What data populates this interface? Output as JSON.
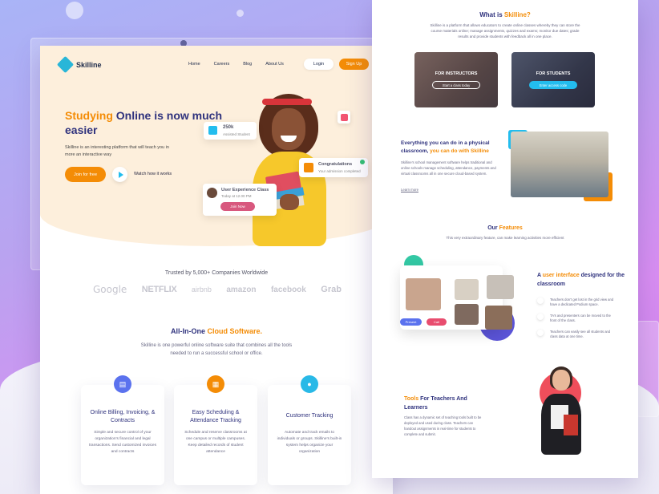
{
  "left_page": {
    "logo": "Skilline",
    "nav": [
      "Home",
      "Careers",
      "Blog",
      "About Us"
    ],
    "login": "Login",
    "signup": "Sign Up",
    "hero_title_accent": "Studying",
    "hero_title_rest": " Online is now much easier",
    "hero_sub": "Skilline is an interesting platform that will teach you in more an interactive way",
    "join_btn": "Join for free",
    "watch": "Watch how it works",
    "card_students_num": "250k",
    "card_students_label": "Assisted Student",
    "card_congrats_title": "Congratulations",
    "card_congrats_sub": "Your admission completed",
    "card_class_title": "User Experience Class",
    "card_class_time": "Today at 12.00 PM",
    "card_class_btn": "Join Now",
    "trusted": "Trusted by 5,000+ Companies Worldwide",
    "logos": [
      "Google",
      "NETFLIX",
      "airbnb",
      "amazon",
      "facebook",
      "Grab"
    ],
    "aio_title_prefix": "All-In-One ",
    "aio_title_accent": "Cloud Software.",
    "aio_desc": "Skilline is one powerful online software suite that combines all the tools needed to run a successful school or office.",
    "features": [
      {
        "title": "Online Billing, Invoicing, & Contracts",
        "desc": "Simple and secure control of your organization’s financial and legal transactions. Send customized invoices and contracts",
        "color": "#5b72ee",
        "icon": "document-icon"
      },
      {
        "title": "Easy Scheduling & Attendance Tracking",
        "desc": "Schedule and reserve classrooms at one campus or multiple campuses. Keep detailed records of student attendance",
        "color": "#f48c06",
        "icon": "calendar-icon"
      },
      {
        "title": "Customer Tracking",
        "desc": "Automate and track emails to individuals or groups. Skilline’s built-in system helps organize your organization",
        "color": "#29b9e7",
        "icon": "users-icon"
      }
    ]
  },
  "right_page": {
    "what_prefix": "What is ",
    "what_accent": "Skilline?",
    "what_desc": "Skilline is a platform that allows educators to create online classes whereby they can store the course materials online; manage assignments, quizzes and exams; monitor due dates; grade results and provide students with feedback all in one place.",
    "instructors_title": "FOR INSTRUCTORS",
    "instructors_btn": "Start a class today",
    "students_title": "FOR STUDENTS",
    "students_btn": "Enter access code",
    "sec2_title_a": "Everything you can do in a physical classroom, ",
    "sec2_title_accent": "you can do with Skilline",
    "sec2_desc": "Skilline’s school management software helps traditional and online schools manage scheduling, attendance, payments and virtual classrooms all in one secure cloud-based system.",
    "learn_more": "Learn more",
    "feat_prefix": "Our ",
    "feat_accent": "Features",
    "feat_desc": "This very extraordinary feature, can make learning activities more efficient",
    "present_btn": "Present",
    "call_btn": "Call",
    "ui_title_a": "A ",
    "ui_title_accent": "user interface",
    "ui_title_b": " designed for the classroom",
    "ui_items": [
      "Teachers don’t get lost in the grid view and have a dedicated Podium space.",
      "TA’s and presenters can be moved to the front of the class.",
      "Teachers can easily see all students and class data at one time."
    ],
    "tools_accent": "Tools",
    "tools_title_rest": " For Teachers And Learners",
    "tools_desc": "Class has a dynamic set of teaching tools built to be deployed and used during class. Teachers can handout assignments in real-time for students to complete and submit."
  }
}
